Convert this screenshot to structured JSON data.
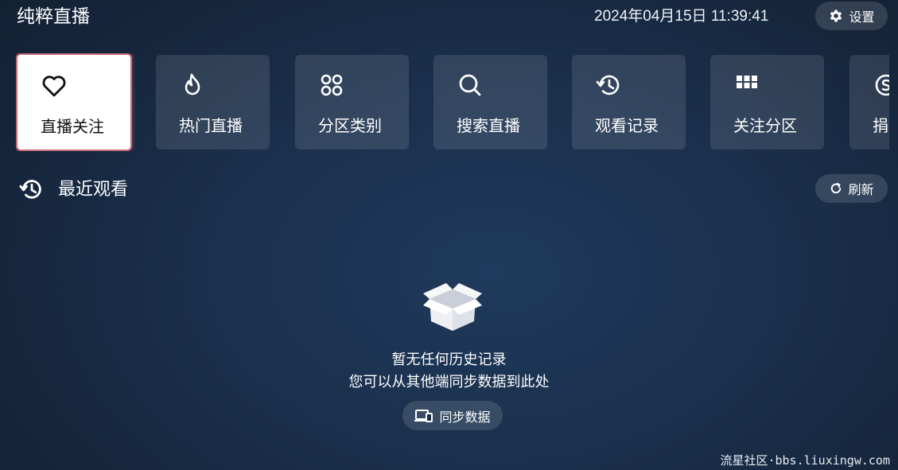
{
  "header": {
    "app_title": "纯粹直播",
    "datetime": "2024年04月15日 11:39:41",
    "settings_label": "设置",
    "settings_icon": "gear-icon"
  },
  "nav_cards": [
    {
      "label": "直播关注",
      "icon": "heart-icon",
      "active": true
    },
    {
      "label": "热门直播",
      "icon": "flame-icon",
      "active": false
    },
    {
      "label": "分区类别",
      "icon": "category-grid-icon",
      "active": false
    },
    {
      "label": "搜索直播",
      "icon": "search-icon",
      "active": false
    },
    {
      "label": "观看记录",
      "icon": "history-icon",
      "active": false
    },
    {
      "label": "关注分区",
      "icon": "grid-icon",
      "active": false
    },
    {
      "label": "捐",
      "icon": "donate-coin-icon",
      "active": false
    }
  ],
  "recent": {
    "title": "最近观看",
    "icon": "history-icon",
    "refresh_label": "刷新",
    "refresh_icon": "refresh-icon"
  },
  "empty_state": {
    "icon": "empty-box-icon",
    "title": "暂无任何历史记录",
    "subtitle": "您可以从其他端同步数据到此处",
    "sync_label": "同步数据",
    "sync_icon": "devices-icon"
  },
  "watermark": "流星社区·bbs.liuxingw.com",
  "colors": {
    "background": "#1a2f4b",
    "card_bg": "#2b4260",
    "active_card_bg": "#ffffff",
    "active_border": "#c86a76"
  }
}
